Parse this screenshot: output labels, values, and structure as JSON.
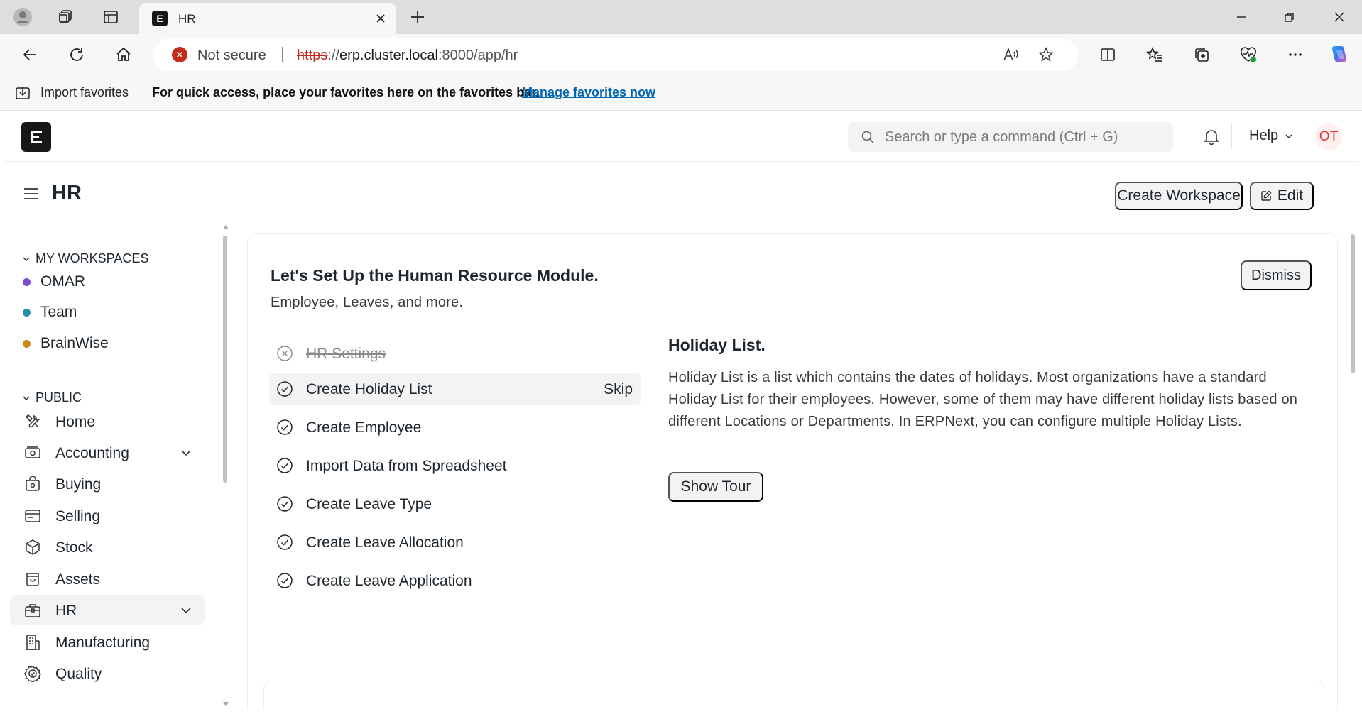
{
  "browser": {
    "tab_title": "HR",
    "tab_favicon_letter": "E",
    "security_label": "Not secure",
    "url_protocol": "https",
    "url_host": "erp.cluster.local",
    "url_rest": ":8000/app/hr",
    "favorites_bar": {
      "import_label": "Import favorites",
      "message": "For quick access, place your favorites here on the favorites bar.",
      "link": "Manage favorites now"
    }
  },
  "navbar": {
    "logo_letter": "E",
    "search_placeholder": "Search or type a command (Ctrl + G)",
    "help_label": "Help",
    "avatar_initials": "OT"
  },
  "page": {
    "title": "HR",
    "create_workspace_label": "Create Workspace",
    "edit_label": "Edit"
  },
  "sidebar": {
    "my_workspaces_label": "MY WORKSPACES",
    "my_workspaces": [
      {
        "label": "OMAR",
        "color": "#7c4bd3"
      },
      {
        "label": "Team",
        "color": "#2490a8"
      },
      {
        "label": "BrainWise",
        "color": "#c98a13"
      }
    ],
    "public_label": "PUBLIC",
    "public_items": [
      {
        "label": "Home",
        "icon": "tools-icon"
      },
      {
        "label": "Accounting",
        "icon": "accounting-icon",
        "expandable": true
      },
      {
        "label": "Buying",
        "icon": "buying-icon"
      },
      {
        "label": "Selling",
        "icon": "selling-icon"
      },
      {
        "label": "Stock",
        "icon": "stock-icon"
      },
      {
        "label": "Assets",
        "icon": "assets-icon"
      },
      {
        "label": "HR",
        "icon": "hr-icon",
        "expandable": true,
        "active": true
      },
      {
        "label": "Manufacturing",
        "icon": "manufacturing-icon"
      },
      {
        "label": "Quality",
        "icon": "quality-icon"
      }
    ]
  },
  "onboarding": {
    "title": "Let's Set Up the Human Resource Module.",
    "subtitle": "Employee, Leaves, and more.",
    "dismiss_label": "Dismiss",
    "skip_label": "Skip",
    "steps": [
      {
        "label": "HR Settings",
        "state": "skipped"
      },
      {
        "label": "Create Holiday List",
        "state": "active"
      },
      {
        "label": "Create Employee",
        "state": "pending"
      },
      {
        "label": "Import Data from Spreadsheet",
        "state": "pending"
      },
      {
        "label": "Create Leave Type",
        "state": "pending"
      },
      {
        "label": "Create Leave Allocation",
        "state": "pending"
      },
      {
        "label": "Create Leave Application",
        "state": "pending"
      }
    ],
    "detail": {
      "title": "Holiday List.",
      "body": "Holiday List is a list which contains the dates of holidays. Most organizations have a standard Holiday List for their employees. However, some of them may have different holiday lists based on different Locations or Departments. In ERPNext, you can configure multiple Holiday Lists.",
      "button_label": "Show Tour"
    }
  }
}
